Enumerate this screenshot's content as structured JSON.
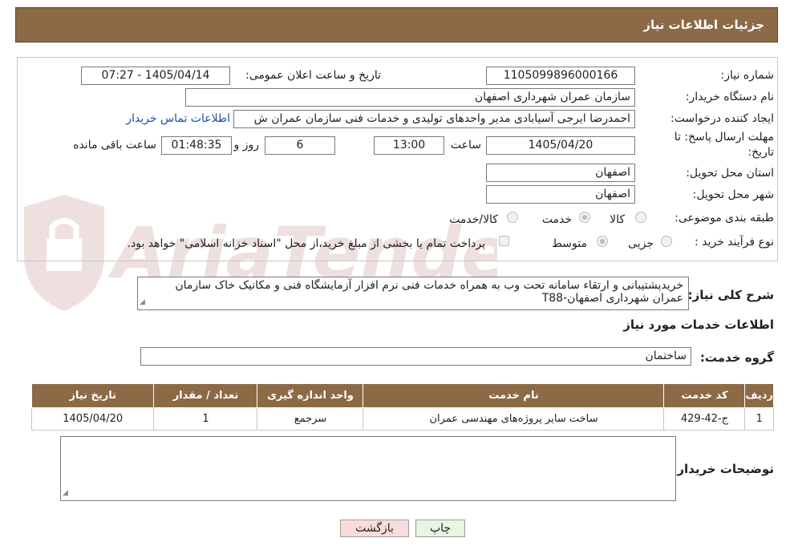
{
  "header": {
    "title": "جزئیات اطلاعات نیاز"
  },
  "form": {
    "need_number_label": "شماره نیاز:",
    "need_number": "1105099896000166",
    "announce_label": "تاریخ و ساعت اعلان عمومی:",
    "announce_value": "1405/04/14 - 07:27",
    "buyer_org_label": "نام دستگاه خریدار:",
    "buyer_org": "سازمان عمران شهرداری اصفهان",
    "requester_label": "ایجاد کننده درخواست:",
    "requester": "احمدرضا ایرجی آسیابادی مدیر واحدهای تولیدی و خدمات فنی سازمان عمران ش",
    "contact_link": "اطلاعات تماس خریدار",
    "deadline_label_1": "مهلت ارسال پاسخ: تا",
    "deadline_label_2": "تاریخ:",
    "deadline_date": "1405/04/20",
    "time_label": "ساعت",
    "deadline_time": "13:00",
    "days_value": "6",
    "days_label": "روز و",
    "remaining_value": "01:48:35",
    "remaining_label": "ساعت باقی مانده",
    "province_label": "استان محل تحویل:",
    "province": "اصفهان",
    "city_label": "شهر محل تحویل:",
    "city": "اصفهان",
    "category_label": "طبقه بندی موضوعی:",
    "category_options": [
      "کالا",
      "خدمت",
      "کالا/خدمت"
    ],
    "category_selected": "خدمت",
    "process_label": "نوع فرآیند خرید :",
    "process_options": [
      "جزیی",
      "متوسط"
    ],
    "process_selected": "متوسط",
    "payment_note": "پرداخت تمام یا بخشی از مبلغ خرید،از محل \"اسناد خزانه اسلامی\" خواهد بود."
  },
  "summary": {
    "label": "شرح کلی نیاز:",
    "line1": "خریدپشتیبانی و ارتقاء سامانه تحت وب به همراه خدمات فنی نرم افزار آزمایشگاه فنی و مکانیک خاک سازمان",
    "line2": "عمران شهرداری اصفهان-T88"
  },
  "services": {
    "section_title": "اطلاعات خدمات مورد نیاز",
    "group_label": "گروه خدمت:",
    "group_value": "ساختمان",
    "columns": [
      "ردیف",
      "کد خدمت",
      "نام خدمت",
      "واحد اندازه گیری",
      "تعداد / مقدار",
      "تاریخ نیاز"
    ],
    "rows": [
      [
        "1",
        "ج-42-429",
        "ساخت سایر پروژه‌های مهندسی عمران",
        "سرجمع",
        "1",
        "1405/04/20"
      ]
    ]
  },
  "notes": {
    "label": "توضیحات خریدار:",
    "value": ""
  },
  "buttons": {
    "print": "چاپ",
    "back": "بازگشت"
  },
  "watermark": {
    "text": "AriaTender.neT"
  },
  "colors": {
    "header_bg": "#8c6a46",
    "link": "#1b4fa8",
    "back_button": "#f8dcdc",
    "print_button": "#e6f6e0"
  }
}
